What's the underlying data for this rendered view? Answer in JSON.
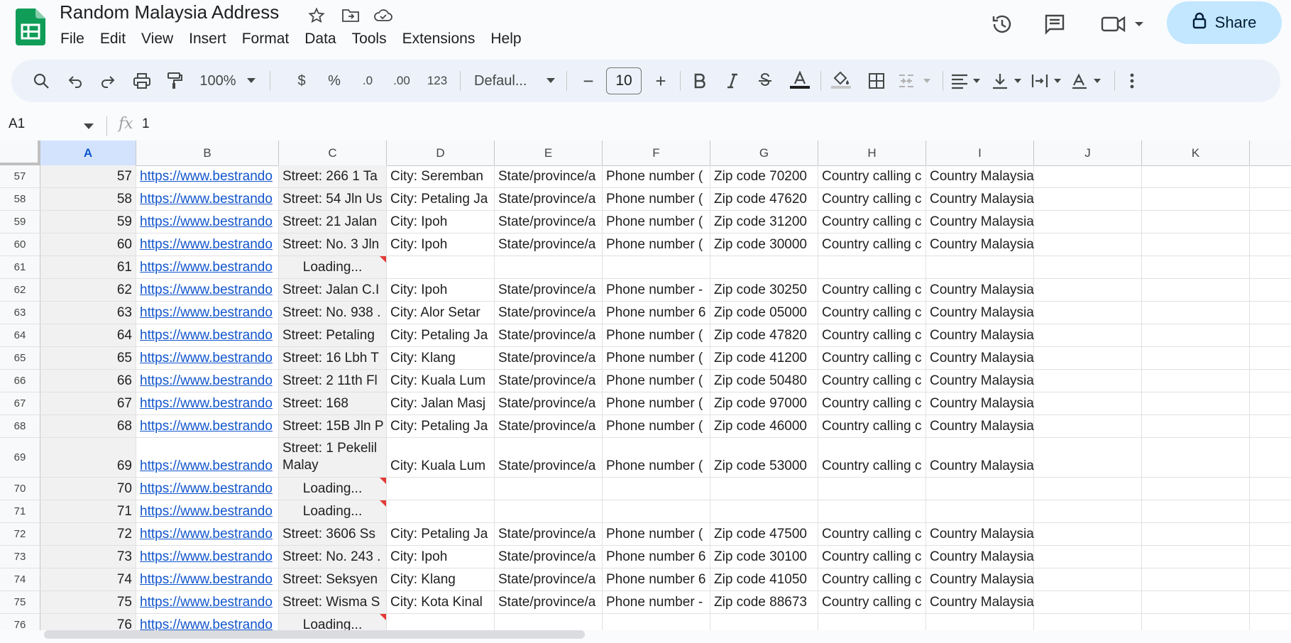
{
  "doc": {
    "title": "Random Malaysia Address"
  },
  "menu": [
    "File",
    "Edit",
    "View",
    "Insert",
    "Format",
    "Data",
    "Tools",
    "Extensions",
    "Help"
  ],
  "share": {
    "label": "Share"
  },
  "toolbar": {
    "zoom": "100%",
    "currency": "$",
    "percent": "%",
    "dec_decrease": ".0",
    "dec_increase": ".00",
    "number_format": "123",
    "font": "Defaul...",
    "font_size": "10",
    "minus": "−",
    "plus": "+"
  },
  "formula_bar": {
    "name_box": "A1",
    "fx": "fx",
    "value": "1"
  },
  "columns": [
    "A",
    "B",
    "C",
    "D",
    "E",
    "F",
    "G",
    "H",
    "I",
    "J",
    "K"
  ],
  "selected_column": "A",
  "loading_text": "Loading...",
  "rows": [
    {
      "num": "57",
      "a": "57",
      "b": "https://www.bestrando",
      "c": "Street:  266 1 Ta",
      "d": "City:   Seremban",
      "e": "State/province/a",
      "f": "Phone number  (",
      "g": "Zip code  70200",
      "h": "Country calling c",
      "i": "Country  Malaysia"
    },
    {
      "num": "58",
      "a": "58",
      "b": "https://www.bestrando",
      "c": "Street:  54 Jln Us",
      "d": "City:   Petaling Ja",
      "e": "State/province/a",
      "f": "Phone number  (",
      "g": "Zip code  47620",
      "h": "Country calling c",
      "i": "Country  Malaysia"
    },
    {
      "num": "59",
      "a": "59",
      "b": "https://www.bestrando",
      "c": "Street:  21 Jalan",
      "d": "City:   Ipoh",
      "e": "State/province/a",
      "f": "Phone number  (",
      "g": "Zip code  31200",
      "h": "Country calling c",
      "i": "Country  Malaysia"
    },
    {
      "num": "60",
      "a": "60",
      "b": "https://www.bestrando",
      "c": "Street:  No. 3 Jln",
      "d": "City:   Ipoh",
      "e": "State/province/a",
      "f": "Phone number  (",
      "g": "Zip code  30000",
      "h": "Country calling c",
      "i": "Country  Malaysia"
    },
    {
      "num": "61",
      "a": "61",
      "b": "https://www.bestrando",
      "loading": true
    },
    {
      "num": "62",
      "a": "62",
      "b": "https://www.bestrando",
      "c": "Street:  Jalan C.I",
      "d": "City:   Ipoh",
      "e": "State/province/a",
      "f": "Phone number  -",
      "g": "Zip code  30250",
      "h": "Country calling c",
      "i": "Country  Malaysia"
    },
    {
      "num": "63",
      "a": "63",
      "b": "https://www.bestrando",
      "c": "Street:  No. 938 .",
      "d": "City:   Alor Setar",
      "e": "State/province/a",
      "f": "Phone number  6",
      "g": "Zip code  05000",
      "h": "Country calling c",
      "i": "Country  Malaysia"
    },
    {
      "num": "64",
      "a": "64",
      "b": "https://www.bestrando",
      "c": "Street:  Petaling",
      "d": "City:   Petaling Ja",
      "e": "State/province/a",
      "f": "Phone number  (",
      "g": "Zip code  47820",
      "h": "Country calling c",
      "i": "Country  Malaysia"
    },
    {
      "num": "65",
      "a": "65",
      "b": "https://www.bestrando",
      "c": "Street:  16 Lbh T",
      "d": "City:   Klang",
      "e": "State/province/a",
      "f": "Phone number  (",
      "g": "Zip code  41200",
      "h": "Country calling c",
      "i": "Country  Malaysia"
    },
    {
      "num": "66",
      "a": "66",
      "b": "https://www.bestrando",
      "c": "Street:  2 11th Fl",
      "d": "City:   Kuala Lum",
      "e": "State/province/a",
      "f": "Phone number  (",
      "g": "Zip code  50480",
      "h": "Country calling c",
      "i": "Country  Malaysia"
    },
    {
      "num": "67",
      "a": "67",
      "b": "https://www.bestrando",
      "c": "Street:  168",
      "d": "City:  Jalan Masj",
      "e": "State/province/a",
      "f": "Phone number  (",
      "g": "Zip code  97000",
      "h": "Country calling c",
      "i": "Country  Malaysia"
    },
    {
      "num": "68",
      "a": "68",
      "b": "https://www.bestrando",
      "c": "Street:  15B Jln P",
      "d": "City:   Petaling Ja",
      "e": "State/province/a",
      "f": "Phone number  (",
      "g": "Zip code  46000",
      "h": "Country calling c",
      "i": "Country  Malaysia"
    },
    {
      "num": "69",
      "a": "69",
      "b": "https://www.bestrando",
      "c": "Street:  1 Pekelil",
      "c2": "Malay",
      "tall": true,
      "d": "City:   Kuala Lum",
      "e": "State/province/a",
      "f": "Phone number  (",
      "g": "Zip code  53000",
      "h": "Country calling c",
      "i": "Country  Malaysia"
    },
    {
      "num": "70",
      "a": "70",
      "b": "https://www.bestrando",
      "loading": true
    },
    {
      "num": "71",
      "a": "71",
      "b": "https://www.bestrando",
      "loading": true
    },
    {
      "num": "72",
      "a": "72",
      "b": "https://www.bestrando",
      "c": "Street:  3606 Ss",
      "d": "City:   Petaling Ja",
      "e": "State/province/a",
      "f": "Phone number  (",
      "g": "Zip code  47500",
      "h": "Country calling c",
      "i": "Country  Malaysia"
    },
    {
      "num": "73",
      "a": "73",
      "b": "https://www.bestrando",
      "c": "Street:  No. 243 .",
      "d": "City:   Ipoh",
      "e": "State/province/a",
      "f": "Phone number  6",
      "g": "Zip code  30100",
      "h": "Country calling c",
      "i": "Country  Malaysia"
    },
    {
      "num": "74",
      "a": "74",
      "b": "https://www.bestrando",
      "c": "Street:  Seksyen",
      "d": "City:   Klang",
      "e": "State/province/a",
      "f": "Phone number  6",
      "g": "Zip code  41050",
      "h": "Country calling c",
      "i": "Country  Malaysia"
    },
    {
      "num": "75",
      "a": "75",
      "b": "https://www.bestrando",
      "c": "Street:  Wisma S",
      "d": "City:   Kota Kinal",
      "e": "State/province/a",
      "f": "Phone number  -",
      "g": "Zip code  88673",
      "h": "Country calling c",
      "i": "Country  Malaysia"
    },
    {
      "num": "76",
      "a": "76",
      "b": "https://www.bestrando",
      "loading": true
    }
  ]
}
